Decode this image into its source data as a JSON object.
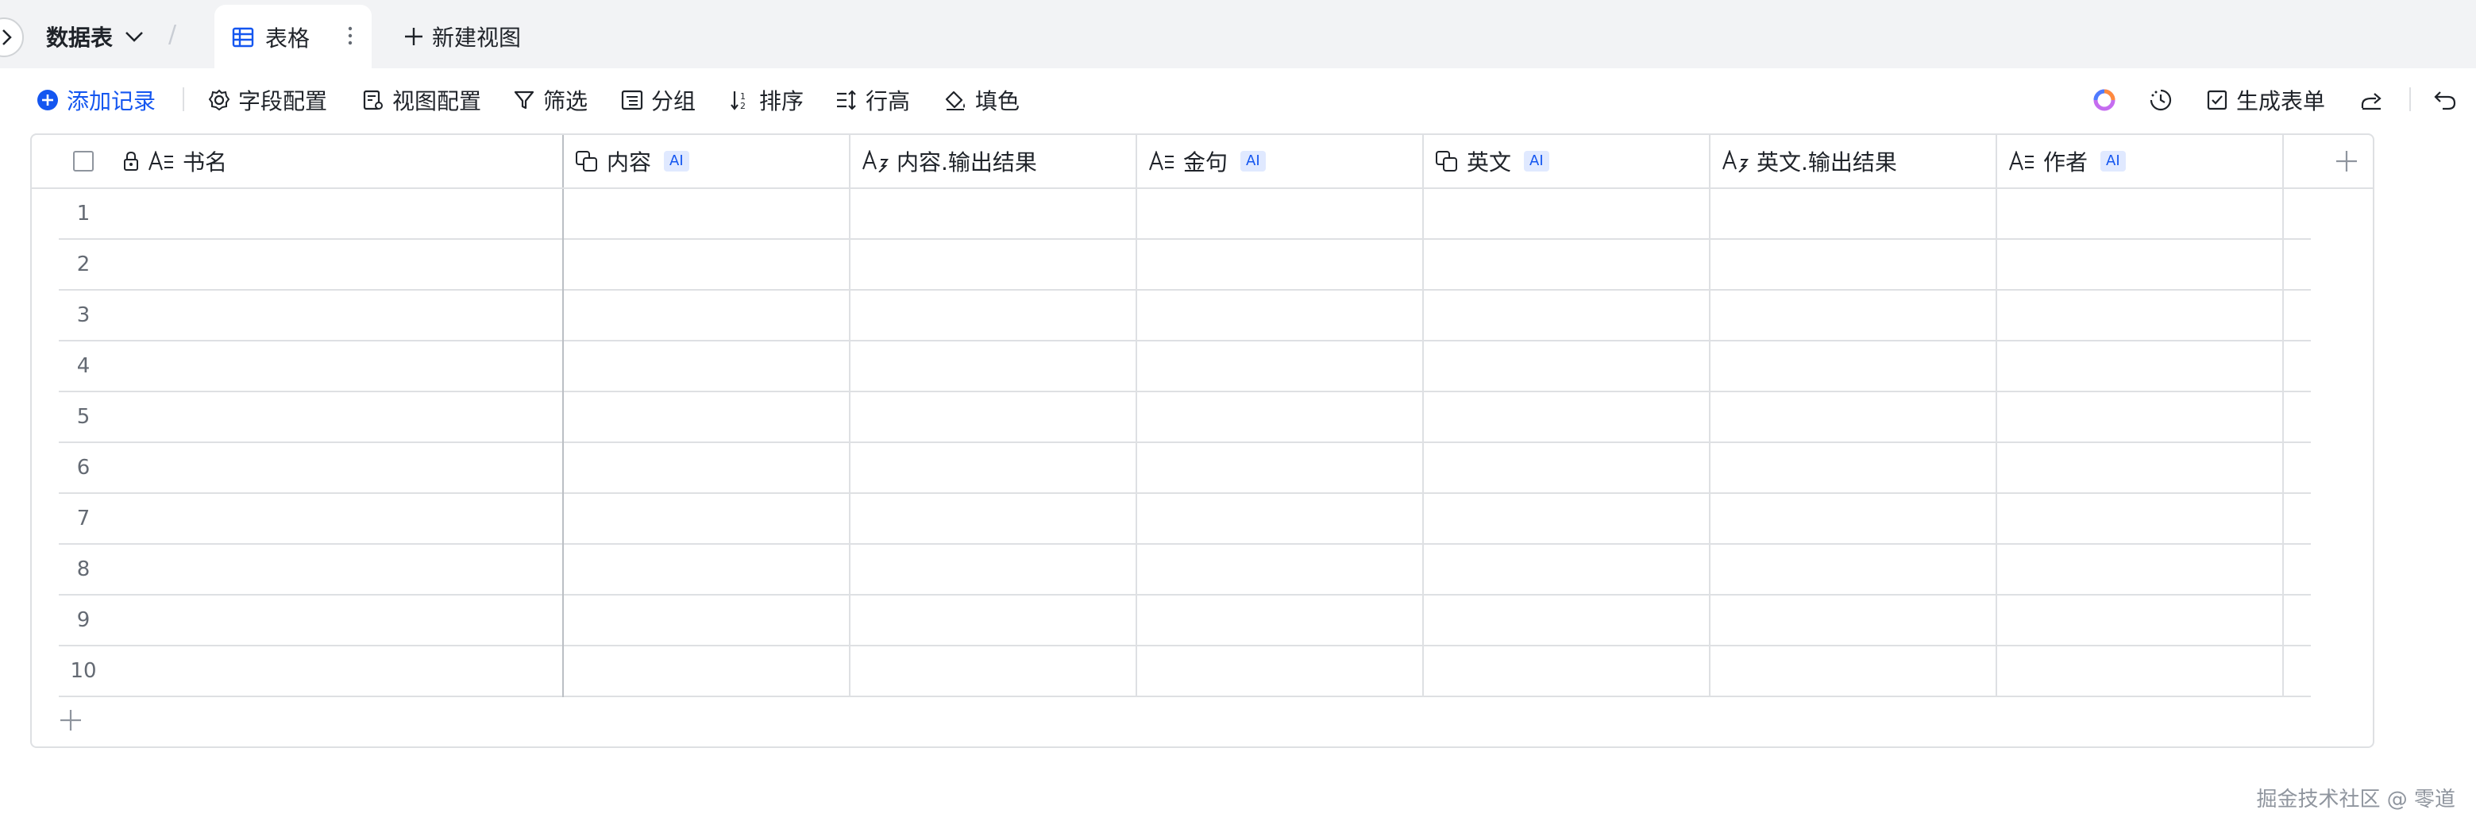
{
  "topbar": {
    "database_label": "数据表",
    "active_tab_label": "表格",
    "new_view_label": "新建视图"
  },
  "toolbar": {
    "add_record": "添加记录",
    "field_config": "字段配置",
    "view_config": "视图配置",
    "filter": "筛选",
    "group": "分组",
    "sort": "排序",
    "row_height": "行高",
    "fill_color": "填色",
    "generate_form": "生成表单"
  },
  "table": {
    "columns": [
      {
        "label": "书名",
        "ai": false
      },
      {
        "label": "内容",
        "ai": true,
        "ai_label": "AI"
      },
      {
        "label": "内容.输出结果",
        "ai": false
      },
      {
        "label": "金句",
        "ai": true,
        "ai_label": "AI"
      },
      {
        "label": "英文",
        "ai": true,
        "ai_label": "AI"
      },
      {
        "label": "英文.输出结果",
        "ai": false
      },
      {
        "label": "作者",
        "ai": true,
        "ai_label": "AI"
      }
    ],
    "row_numbers": [
      "1",
      "2",
      "3",
      "4",
      "5",
      "6",
      "7",
      "8",
      "9",
      "10"
    ]
  },
  "watermark": "掘金技术社区 @ 零道",
  "colors": {
    "accent": "#1456f0",
    "ai_badge_bg": "#e0e9ff",
    "topbar_bg": "#f2f3f5",
    "border": "#dee0e3"
  }
}
